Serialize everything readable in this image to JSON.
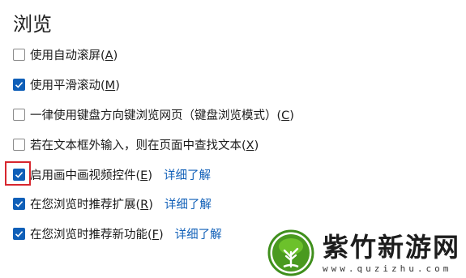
{
  "section": {
    "title": "浏览"
  },
  "options": [
    {
      "text": "使用自动滚屏(",
      "key": "A",
      "tail": ")",
      "checked": false,
      "link": ""
    },
    {
      "text": "使用平滑滚动(",
      "key": "M",
      "tail": ")",
      "checked": true,
      "link": ""
    },
    {
      "text": "一律使用键盘方向键浏览网页（键盘浏览模式）(",
      "key": "C",
      "tail": ")",
      "checked": false,
      "link": ""
    },
    {
      "text": "若在文本框外输入，则在页面中查找文本(",
      "key": "X",
      "tail": ")",
      "checked": false,
      "link": ""
    },
    {
      "text": "启用画中画视频控件(",
      "key": "E",
      "tail": ")",
      "checked": true,
      "link": "详细了解"
    },
    {
      "text": "在您浏览时推荐扩展(",
      "key": "R",
      "tail": ")",
      "checked": true,
      "link": "详细了解"
    },
    {
      "text": "在您浏览时推荐新功能(",
      "key": "F",
      "tail": ")",
      "checked": true,
      "link": "详细了解"
    }
  ],
  "watermark": {
    "name": "紫竹新游网",
    "url": "www.quzizhu.com"
  },
  "colors": {
    "accent": "#0f5fb8",
    "link": "#1160b8",
    "highlight": "#d7262e"
  }
}
